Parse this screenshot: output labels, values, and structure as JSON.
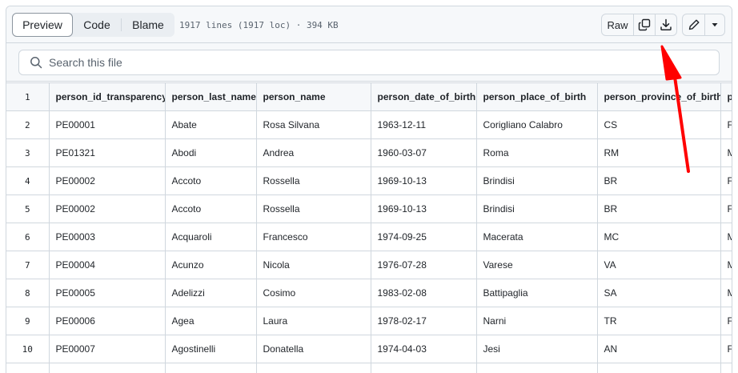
{
  "toolbar": {
    "tabs": [
      {
        "label": "Preview",
        "active": true
      },
      {
        "label": "Code",
        "active": false
      },
      {
        "label": "Blame",
        "active": false
      }
    ],
    "file_info": "1917 lines (1917 loc) · 394 KB",
    "raw_label": "Raw",
    "icons": [
      "copy-icon",
      "download-icon",
      "pencil-icon",
      "triangle-down-icon"
    ]
  },
  "search": {
    "placeholder": "Search this file",
    "value": ""
  },
  "table": {
    "line_numbers": [
      "1",
      "2",
      "3",
      "4",
      "5",
      "6",
      "7",
      "8",
      "9",
      "10"
    ],
    "headers": [
      "person_id_transparency",
      "person_last_name",
      "person_name",
      "person_date_of_birth",
      "person_place_of_birth",
      "person_province_of_birth",
      "p"
    ],
    "rows": [
      [
        "PE00001",
        "Abate",
        "Rosa Silvana",
        "1963-12-11",
        "Corigliano Calabro",
        "CS",
        "F"
      ],
      [
        "PE01321",
        "Abodi",
        "Andrea",
        "1960-03-07",
        "Roma",
        "RM",
        "M"
      ],
      [
        "PE00002",
        "Accoto",
        "Rossella",
        "1969-10-13",
        "Brindisi",
        "BR",
        "F"
      ],
      [
        "PE00002",
        "Accoto",
        "Rossella",
        "1969-10-13",
        "Brindisi",
        "BR",
        "F"
      ],
      [
        "PE00003",
        "Acquaroli",
        "Francesco",
        "1974-09-25",
        "Macerata",
        "MC",
        "M"
      ],
      [
        "PE00004",
        "Acunzo",
        "Nicola",
        "1976-07-28",
        "Varese",
        "VA",
        "M"
      ],
      [
        "PE00005",
        "Adelizzi",
        "Cosimo",
        "1983-02-08",
        "Battipaglia",
        "SA",
        "M"
      ],
      [
        "PE00006",
        "Agea",
        "Laura",
        "1978-02-17",
        "Narni",
        "TR",
        "F"
      ],
      [
        "PE00007",
        "Agostinelli",
        "Donatella",
        "1974-04-03",
        "Jesi",
        "AN",
        "F"
      ]
    ]
  },
  "colors": {
    "annotation_arrow": "#ff0000",
    "border": "#d0d7de",
    "toolbar_bg": "#f6f8fa"
  }
}
